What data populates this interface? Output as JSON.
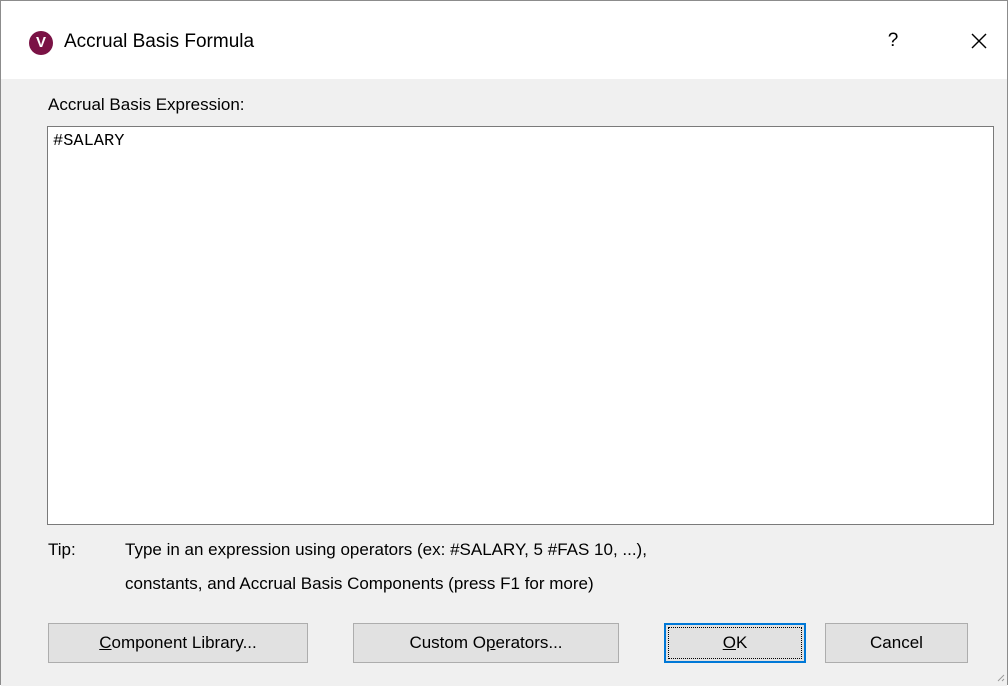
{
  "window": {
    "title": "Accrual Basis Formula",
    "app_icon_letter": "V",
    "help_label": "?",
    "close_icon": "close-icon"
  },
  "expression": {
    "label": "Accrual Basis Expression:",
    "value": "#SALARY"
  },
  "tip": {
    "label": "Tip:",
    "line1": "Type in an expression using operators (ex: #SALARY, 5 #FAS 10, ...),",
    "line2": "constants, and Accrual Basis Components (press F1 for more)"
  },
  "buttons": {
    "component_library": {
      "mnemonic": "C",
      "rest": "omponent Library..."
    },
    "custom_operators": {
      "prefix": "Custom O",
      "mnemonic": "p",
      "rest": "erators..."
    },
    "ok": {
      "mnemonic": "O",
      "rest": "K"
    },
    "cancel": "Cancel"
  },
  "colors": {
    "app_icon": "#7a1245",
    "dialog_bg": "#f0f0f0",
    "button_bg": "#e1e1e1",
    "default_button_border": "#0078d7"
  }
}
